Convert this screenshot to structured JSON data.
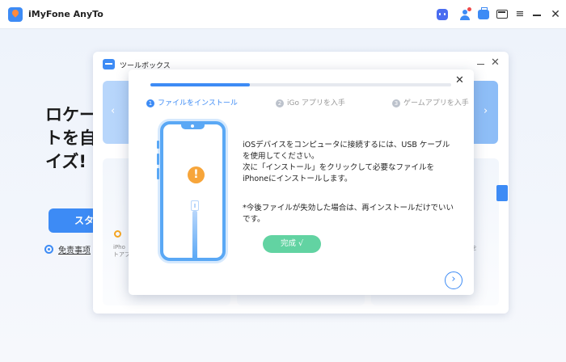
{
  "app": {
    "title": "iMyFone AnyTo",
    "menu_glyph": "≡",
    "close_glyph": "✕"
  },
  "background": {
    "headline_lines": [
      "ロケー",
      "トを自",
      "イズ!"
    ],
    "start_button": "スタ",
    "terms_link": "免责事项"
  },
  "toolbox": {
    "title": "ツールボックス",
    "close_glyph": "✕",
    "arrow_left": "‹",
    "arrow_right": "›",
    "card_text_line1": "iPho",
    "card_text_line2": "トアプ",
    "right_text": "を"
  },
  "dialog": {
    "close_glyph": "✕",
    "progress_percent": 33,
    "steps": [
      {
        "num": "1",
        "label": "ファイルをインストール"
      },
      {
        "num": "2",
        "label": "iGo アプリを入手"
      },
      {
        "num": "3",
        "label": "ゲームアプリを入手"
      }
    ],
    "warning_glyph": "!",
    "instruction": "iOSデバイスをコンピュータに接続するには、USB ケーブルを使用してください。\n次に「インストール」をクリックして必要なファイルをiPhoneにインストールします。",
    "note": "*今後ファイルが失効した場合は、再インストールだけでいいです。",
    "done_button": "完成 √",
    "next_glyph": "›"
  },
  "colors": {
    "accent": "#3d8bf5",
    "done": "#62d3a2",
    "warning": "#f7a53a"
  }
}
